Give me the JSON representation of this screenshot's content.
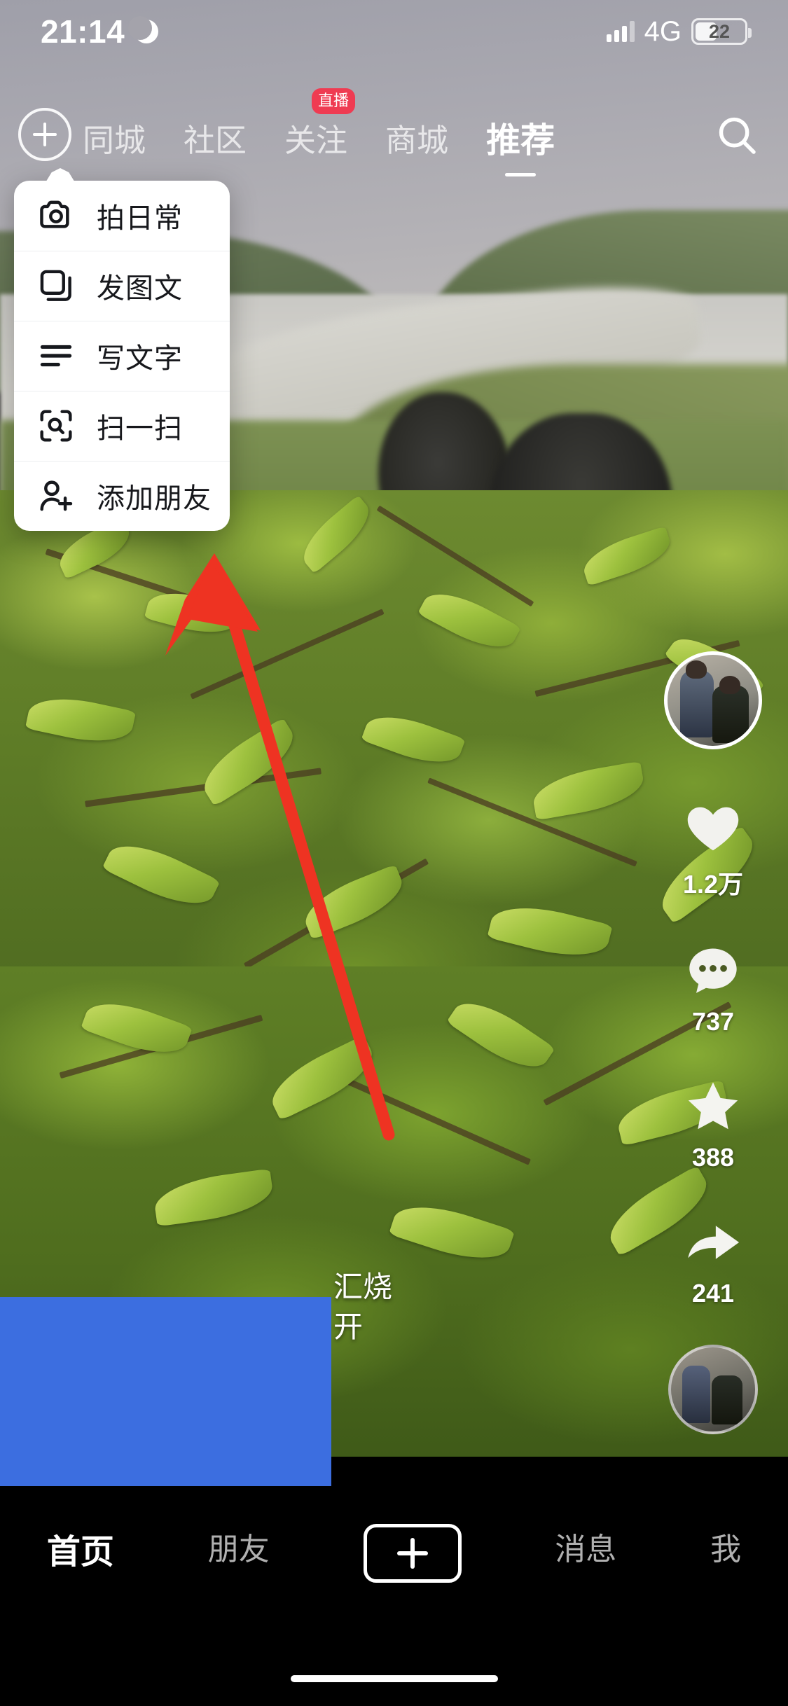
{
  "status_bar": {
    "time": "21:14",
    "moon_icon": "crescent-moon-icon",
    "signal_icon": "signal-bars-icon",
    "network": "4G",
    "battery_percent": "22"
  },
  "top_nav": {
    "add_button_icon": "plus-circle-icon",
    "search_icon": "search-icon",
    "tabs": [
      {
        "label": "同城",
        "active": false,
        "badge": ""
      },
      {
        "label": "社区",
        "active": false,
        "badge": ""
      },
      {
        "label": "关注",
        "active": false,
        "badge": "直播"
      },
      {
        "label": "商城",
        "active": false,
        "badge": ""
      },
      {
        "label": "推荐",
        "active": true,
        "badge": ""
      }
    ],
    "badge_color": "#ef3b52"
  },
  "dropdown_menu": {
    "items": [
      {
        "label": "拍日常",
        "icon": "camera-icon"
      },
      {
        "label": "发图文",
        "icon": "stacked-squares-icon"
      },
      {
        "label": "写文字",
        "icon": "text-lines-icon"
      },
      {
        "label": "扫一扫",
        "icon": "scan-qr-icon"
      },
      {
        "label": "添加朋友",
        "icon": "person-add-icon"
      }
    ]
  },
  "annotation": {
    "arrow_color": "#ee3322",
    "arrow_target": "扫一扫",
    "blue_overlay_color": "#3c6ee0"
  },
  "action_rail": {
    "author_avatar": "author-avatar",
    "items": [
      {
        "icon": "heart-icon",
        "count": "1.2万"
      },
      {
        "icon": "comment-icon",
        "count": "737"
      },
      {
        "icon": "star-icon",
        "count": "388"
      },
      {
        "icon": "share-icon",
        "count": "241"
      }
    ],
    "music_disc": "music-disc-avatar"
  },
  "caption": {
    "line1": "汇烧",
    "line2": "开"
  },
  "bottom_nav": {
    "items": [
      {
        "label": "首页",
        "active": true
      },
      {
        "label": "朋友",
        "active": false
      },
      {
        "label": "",
        "active": false,
        "icon": "plus-box-icon"
      },
      {
        "label": "消息",
        "active": false
      },
      {
        "label": "我",
        "active": false
      }
    ]
  }
}
